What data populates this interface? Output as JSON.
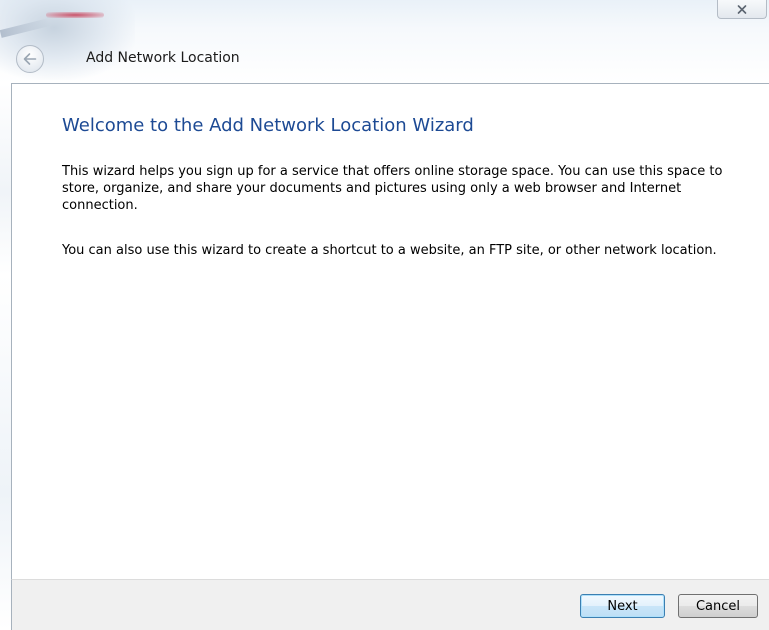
{
  "window": {
    "title": "Add Network Location",
    "close_glyph": "✕"
  },
  "page": {
    "heading": "Welcome to the Add Network Location Wizard",
    "paragraph1": "This wizard helps you sign up for a service that offers online storage space.  You can use this space to store, organize, and share your documents and pictures using only a web browser and Internet connection.",
    "paragraph2": "You can also use this wizard to create a shortcut to a website, an FTP site, or other network location."
  },
  "buttons": {
    "next_label": "Next",
    "cancel_label": "Cancel"
  },
  "icons": {
    "back": "back-arrow-icon",
    "close": "close-icon"
  },
  "colors": {
    "heading": "#1d4a94",
    "footer_bg": "#f0f0f0",
    "default_button_border": "#3c7fb1"
  }
}
